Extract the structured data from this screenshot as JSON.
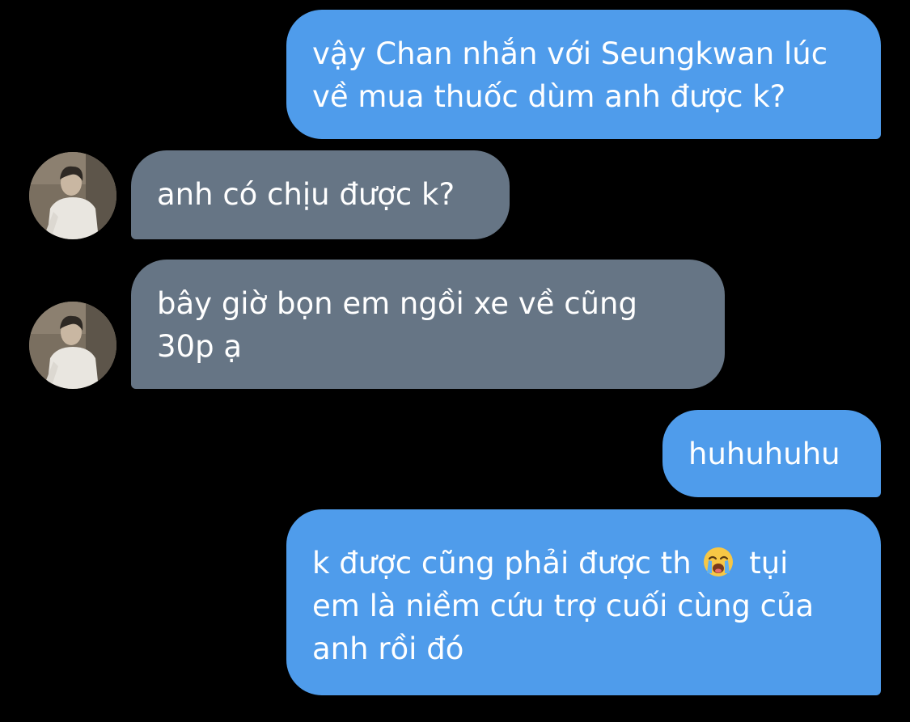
{
  "messages": [
    {
      "sender": "me",
      "lines": [
        "vậy Chan nhắn với Seungkwan lúc",
        "về mua thuốc dùm anh được k?"
      ]
    },
    {
      "sender": "contact",
      "lines": [
        "anh có chịu được k?"
      ]
    },
    {
      "sender": "contact",
      "lines": [
        "bây giờ bọn em ngồi xe về cũng",
        "30p ạ"
      ]
    },
    {
      "sender": "me",
      "lines": [
        "huhuhuhu"
      ]
    },
    {
      "sender": "me",
      "lines": [
        "k được cũng phải được th",
        "tụi",
        "em là niềm cứu trợ cuối cùng của",
        "anh rồi đó"
      ],
      "emoji": "loudly-crying-face-icon"
    }
  ],
  "colors": {
    "background": "#000000",
    "outgoing_bubble": "#4f9ceb",
    "incoming_bubble": "#667585",
    "text": "#ffffff"
  }
}
